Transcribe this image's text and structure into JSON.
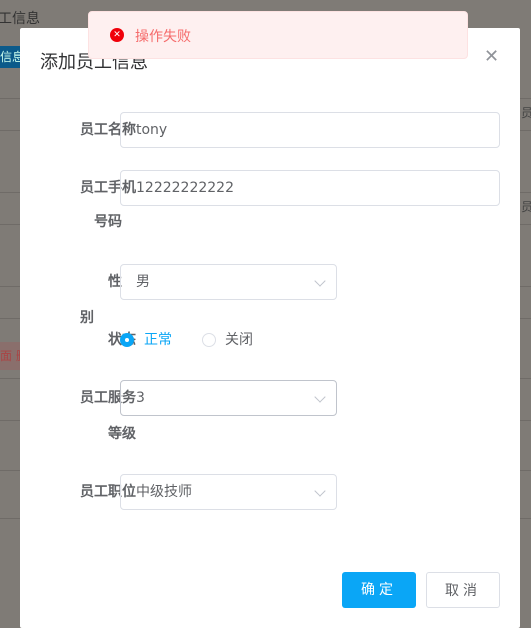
{
  "background": {
    "title": "工信息",
    "tab": "信息",
    "pink_actions": "面 删",
    "right_fragment": "员"
  },
  "toast": {
    "icon": "error-circle-icon",
    "text": "操作失败",
    "color": "#f56c6c"
  },
  "dialog": {
    "title": "添加员工信息",
    "close_icon": "close-icon",
    "fields": {
      "name": {
        "label": "员工名称",
        "value": "tony"
      },
      "phone": {
        "label_line1": "员工手机",
        "label_line2": "号码",
        "value": "12222222222"
      },
      "gender": {
        "label": "性别",
        "value": "男"
      },
      "status": {
        "label": "状态",
        "options": [
          "正常",
          "关闭"
        ],
        "selected": "正常"
      },
      "level": {
        "label_line1": "员工服务",
        "label_line2": "等级",
        "value": "3"
      },
      "position": {
        "label": "员工职位",
        "value": "中级技师"
      }
    },
    "buttons": {
      "confirm": "确定",
      "cancel": "取消"
    },
    "accent": "#0aa6f6"
  }
}
